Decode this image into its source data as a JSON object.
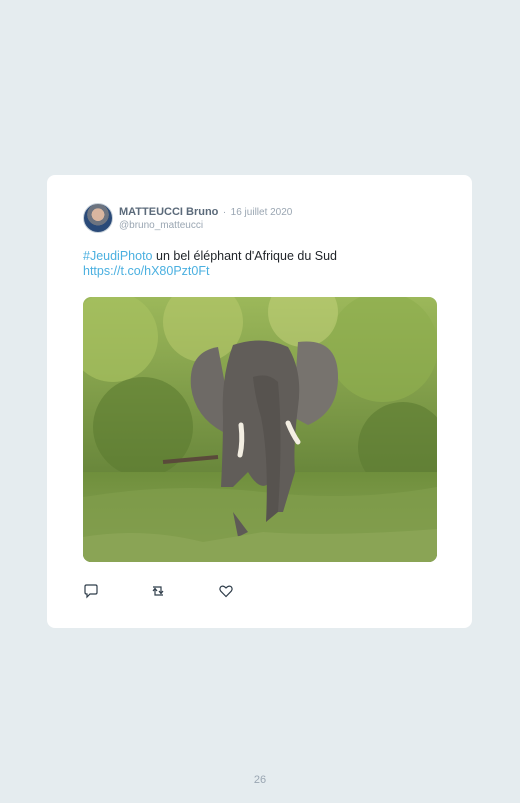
{
  "tweet": {
    "author_name": "MATTEUCCI Bruno",
    "separator": "·",
    "date": "16 juillet 2020",
    "handle": "@bruno_matteucci",
    "hashtag": "#JeudiPhoto",
    "text": " un bel éléphant d'Afrique du Sud",
    "link": "https://t.co/hX80Pzt0Ft"
  },
  "actions": {
    "reply_icon": "reply-bubble-icon",
    "retweet_icon": "retweet-icon",
    "like_icon": "heart-icon"
  },
  "colors": {
    "background": "#e5ecef",
    "card": "#ffffff",
    "link": "#4bb0e0",
    "muted": "#9aa6b2"
  },
  "page": {
    "number": "26"
  }
}
